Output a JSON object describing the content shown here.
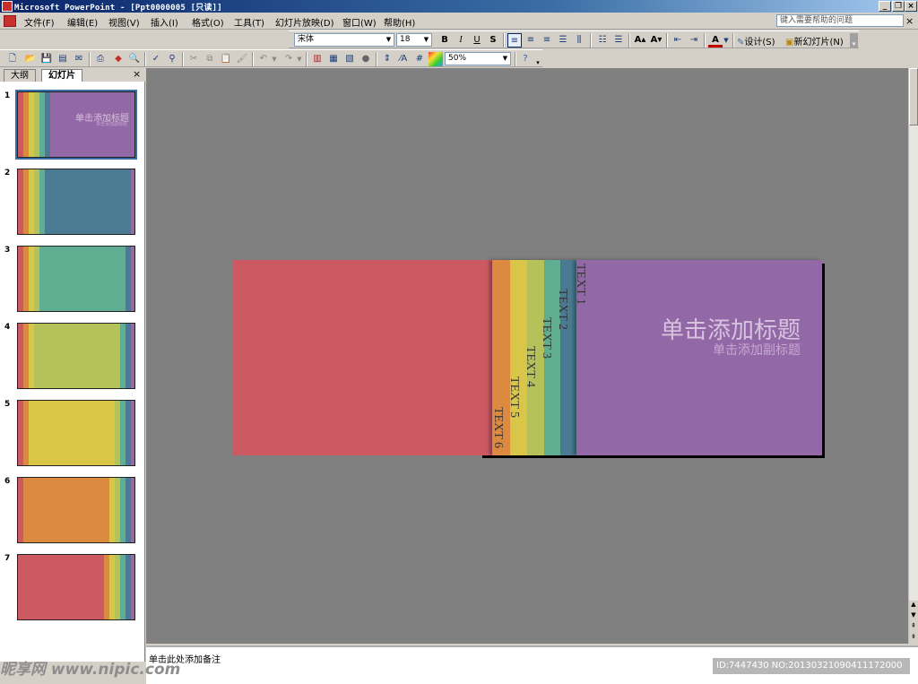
{
  "window": {
    "title": "Microsoft PowerPoint - [Ppt0000005 [只读]]"
  },
  "menu": {
    "items": [
      "文件(F)",
      "编辑(E)",
      "视图(V)",
      "插入(I)",
      "格式(O)",
      "工具(T)",
      "幻灯片放映(D)",
      "窗口(W)",
      "帮助(H)"
    ],
    "help_placeholder": "键入需要帮助的问题"
  },
  "format_toolbar": {
    "font": "宋体",
    "size": "18",
    "bold": "B",
    "italic": "I",
    "underline": "U",
    "shadow": "S",
    "design_label": "设计(S)",
    "new_slide_label": "新幻灯片(N)"
  },
  "std_toolbar": {
    "zoom": "50%"
  },
  "panel": {
    "tab_outline": "大纲",
    "tab_slides": "幻灯片",
    "close": "×",
    "thumbs": [
      {
        "num": "1",
        "title": "单击添加标题",
        "subtitle": "单击添加副标题"
      },
      {
        "num": "2"
      },
      {
        "num": "3"
      },
      {
        "num": "4"
      },
      {
        "num": "5"
      },
      {
        "num": "6"
      },
      {
        "num": "7"
      }
    ]
  },
  "slide": {
    "title": "单击添加标题",
    "subtitle": "单击添加副标题",
    "strips": [
      "TEXT 1",
      "TEXT 2",
      "TEXT 3",
      "TEXT 4",
      "TEXT 5",
      "TEXT 6"
    ]
  },
  "notes": {
    "placeholder": "单击此处添加备注"
  },
  "overlay": {
    "watermark": "昵享网 www.nipic.com",
    "id_line": "ID:7447430 NO:20130321090411172000"
  },
  "colors": {
    "red": "#cd5a63",
    "orange": "#db8a3f",
    "yellow": "#d9c548",
    "lime": "#b5c259",
    "teal": "#5fae91",
    "blue": "#4b7b93",
    "purple": "#9368a6",
    "workarea": "#808080"
  }
}
